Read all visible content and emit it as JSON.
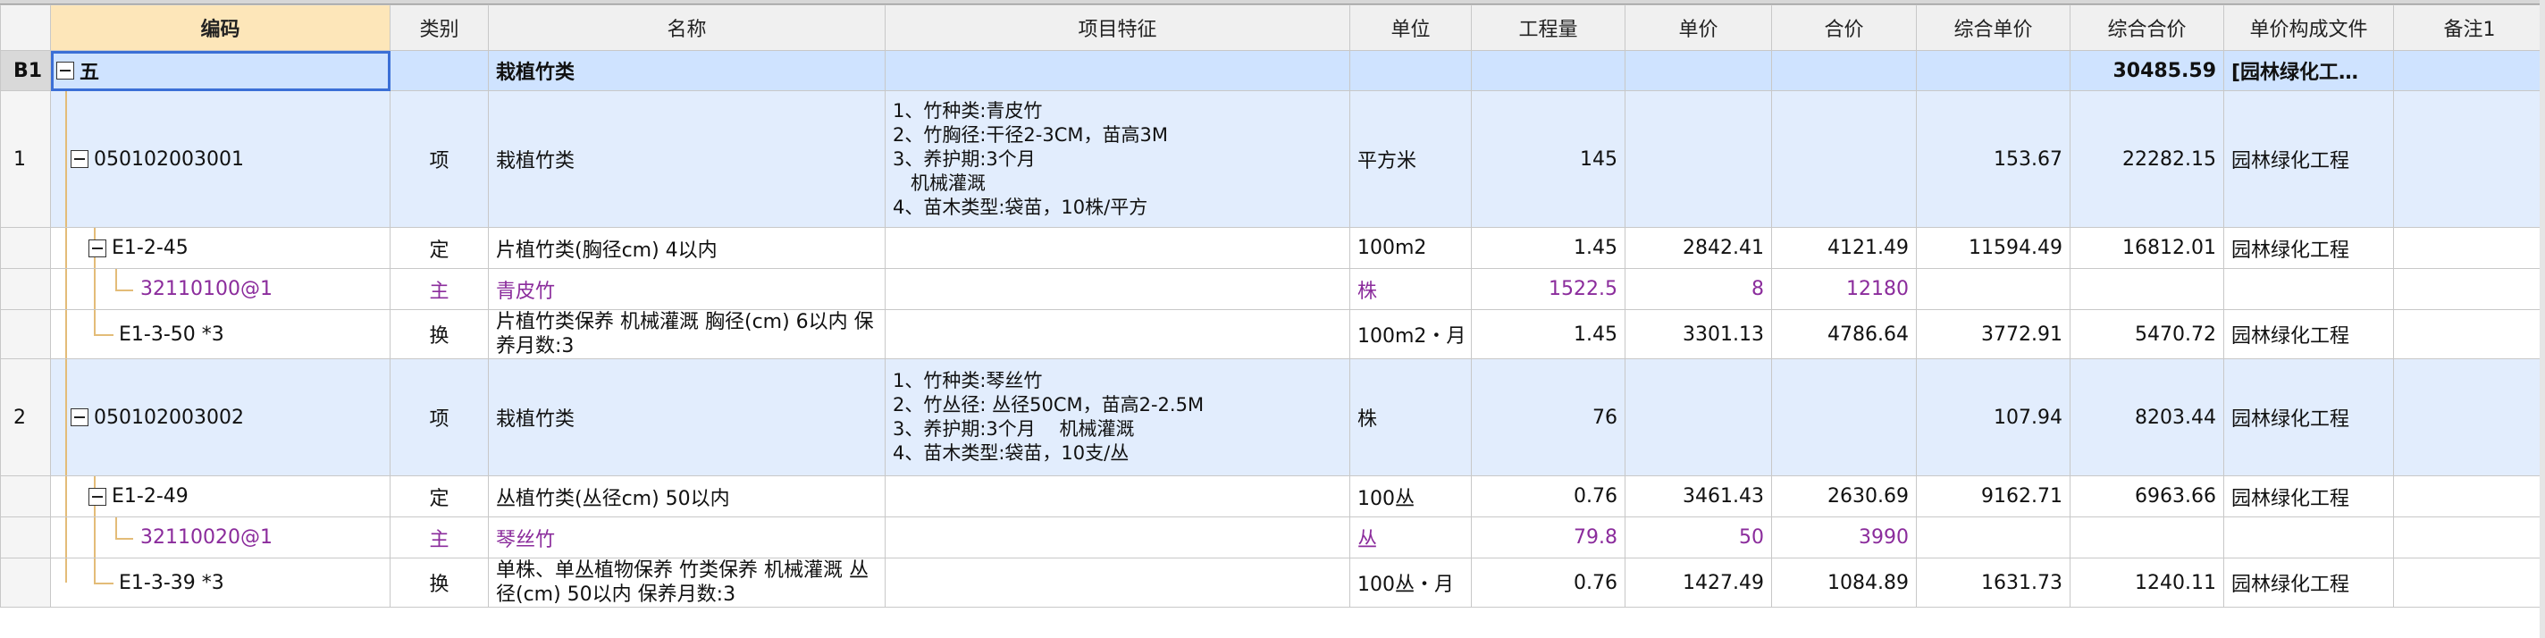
{
  "headers": [
    "编码",
    "类别",
    "名称",
    "项目特征",
    "单位",
    "工程量",
    "单价",
    "合价",
    "综合单价",
    "综合合价",
    "单价构成文件",
    "备注1"
  ],
  "section": {
    "row_no": "B1",
    "code": "五",
    "name": "栽植竹类",
    "total": "30485.59",
    "file": "[园林绿化工…"
  },
  "rows": [
    {
      "no": "1",
      "code": "050102003001",
      "type": "项",
      "name": "栽植竹类",
      "features": "1、竹种类:青皮竹\n2、竹胸径:干径2-3CM，苗高3M\n3、养护期:3个月\n   机械灌溉\n4、苗木类型:袋苗，10株/平方",
      "unit": "平方米",
      "qty": "145",
      "price": "",
      "amount": "",
      "comp_price": "153.67",
      "comp_amount": "22282.15",
      "file": "园林绿化工程",
      "note": ""
    },
    {
      "no": "",
      "code": "E1-2-45",
      "type": "定",
      "name": "片植竹类(胸径cm) 4以内",
      "features": "",
      "unit": "100m2",
      "qty": "1.45",
      "price": "2842.41",
      "amount": "4121.49",
      "comp_price": "11594.49",
      "comp_amount": "16812.01",
      "file": "园林绿化工程",
      "note": ""
    },
    {
      "no": "",
      "code": "32110100@1",
      "type": "主",
      "name": "青皮竹",
      "features": "",
      "unit": "株",
      "qty": "1522.5",
      "price": "8",
      "amount": "12180",
      "comp_price": "",
      "comp_amount": "",
      "file": "",
      "note": ""
    },
    {
      "no": "",
      "code": "E1-3-50 *3",
      "type": "换",
      "name": "片植竹类保养 机械灌溉 胸径(cm) 6以内 保养月数:3",
      "features": "",
      "unit": "100m2・月",
      "qty": "1.45",
      "price": "3301.13",
      "amount": "4786.64",
      "comp_price": "3772.91",
      "comp_amount": "5470.72",
      "file": "园林绿化工程",
      "note": ""
    },
    {
      "no": "2",
      "code": "050102003002",
      "type": "项",
      "name": "栽植竹类",
      "features": "1、竹种类:琴丝竹\n2、竹丛径: 丛径50CM，苗高2-2.5M\n3、养护期:3个月    机械灌溉\n4、苗木类型:袋苗，10支/丛",
      "unit": "株",
      "qty": "76",
      "price": "",
      "amount": "",
      "comp_price": "107.94",
      "comp_amount": "8203.44",
      "file": "园林绿化工程",
      "note": ""
    },
    {
      "no": "",
      "code": "E1-2-49",
      "type": "定",
      "name": "丛植竹类(丛径cm) 50以内",
      "features": "",
      "unit": "100丛",
      "qty": "0.76",
      "price": "3461.43",
      "amount": "2630.69",
      "comp_price": "9162.71",
      "comp_amount": "6963.66",
      "file": "园林绿化工程",
      "note": ""
    },
    {
      "no": "",
      "code": "32110020@1",
      "type": "主",
      "name": "琴丝竹",
      "features": "",
      "unit": "丛",
      "qty": "79.8",
      "price": "50",
      "amount": "3990",
      "comp_price": "",
      "comp_amount": "",
      "file": "",
      "note": ""
    },
    {
      "no": "",
      "code": "E1-3-39 *3",
      "type": "换",
      "name": "单株、单丛植物保养 竹类保养 机械灌溉 丛径(cm) 50以内  保养月数:3",
      "features": "",
      "unit": "100丛・月",
      "qty": "0.76",
      "price": "1427.49",
      "amount": "1084.89",
      "comp_price": "1631.73",
      "comp_amount": "1240.11",
      "file": "园林绿化工程",
      "note": ""
    }
  ],
  "colors": {
    "tree_line": "#e3bc78",
    "purple": "#8b2c9c",
    "section_bg": "#cfe3ff",
    "item_bg": "#e2edfd"
  }
}
